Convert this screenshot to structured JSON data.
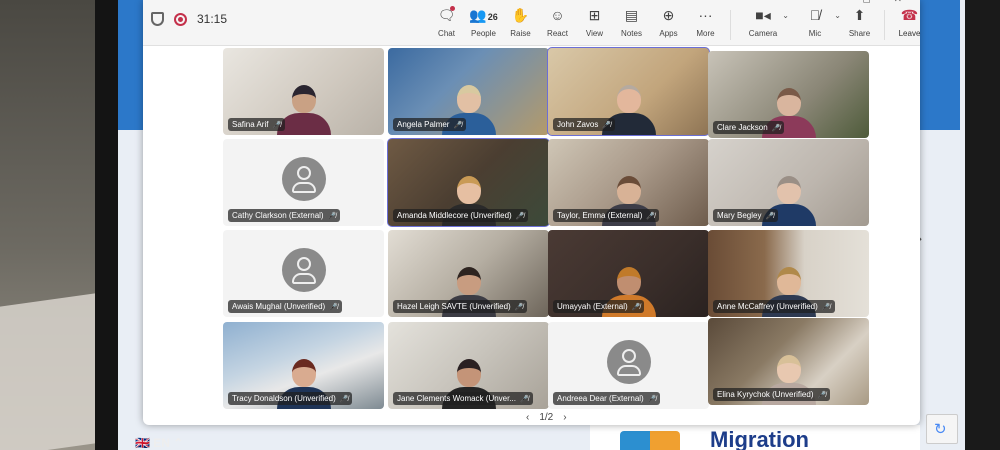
{
  "toolbar": {
    "timer": "31:15",
    "people_count": "26",
    "items": [
      {
        "label": "Chat",
        "icon": "chat-icon"
      },
      {
        "label": "People",
        "icon": "people-icon"
      },
      {
        "label": "Raise",
        "icon": "raise-hand-icon"
      },
      {
        "label": "React",
        "icon": "react-icon"
      },
      {
        "label": "View",
        "icon": "view-grid-icon"
      },
      {
        "label": "Notes",
        "icon": "notes-icon"
      },
      {
        "label": "Apps",
        "icon": "apps-icon"
      },
      {
        "label": "More",
        "icon": "more-icon"
      },
      {
        "label": "Camera",
        "icon": "camera-icon"
      },
      {
        "label": "Mic",
        "icon": "mic-off-icon"
      },
      {
        "label": "Share",
        "icon": "share-icon"
      },
      {
        "label": "Leave",
        "icon": "leave-phone-icon"
      }
    ]
  },
  "participants": [
    {
      "name": "Safina Arif",
      "type": "video"
    },
    {
      "name": "Angela Palmer",
      "type": "video"
    },
    {
      "name": "John Zavos",
      "type": "video"
    },
    {
      "name": "Clare Jackson",
      "type": "video"
    },
    {
      "name": "Cathy Clarkson (External)",
      "type": "avatar"
    },
    {
      "name": "Amanda Middlecore (Unverified)",
      "type": "video"
    },
    {
      "name": "Taylor, Emma (External)",
      "type": "video"
    },
    {
      "name": "Mary Begley",
      "type": "video"
    },
    {
      "name": "Awais Mughal (Unverified)",
      "type": "avatar"
    },
    {
      "name": "Hazel Leigh SAVTE (Unverified)",
      "type": "video"
    },
    {
      "name": "Umayyah (External)",
      "type": "video"
    },
    {
      "name": "Anne McCaffrey (Unverified)",
      "type": "video"
    },
    {
      "name": "Tracy Donaldson (Unverified)",
      "type": "video"
    },
    {
      "name": "Jane Clements Womack (Unver...",
      "type": "video"
    },
    {
      "name": "Andreea Dear (External)",
      "type": "avatar"
    },
    {
      "name": "Elina Kyrychok (Unverified)",
      "type": "video"
    }
  ],
  "pagination": {
    "label": "1/2"
  },
  "page": {
    "language": "EN",
    "banner_text": "Migration"
  },
  "colors": {
    "accent": "#6b6fd6",
    "leave": "#c4314b",
    "recording": "#c4314b"
  }
}
